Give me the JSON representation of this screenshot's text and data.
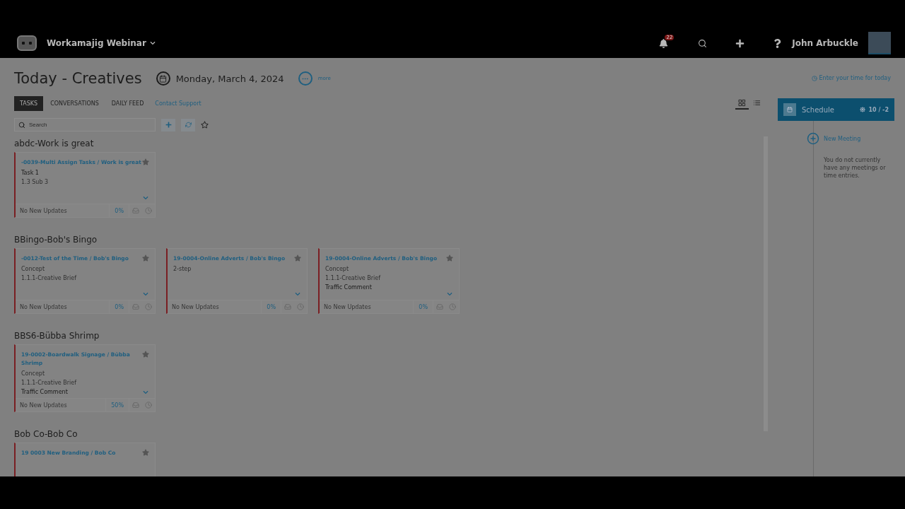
{
  "header": {
    "workspace": "Workamajig Webinar",
    "notification_count": "22",
    "user": "John Arbuckle"
  },
  "page": {
    "title": "Today - Creatives",
    "date": "Monday, March 4, 2024",
    "more": "more",
    "time_link": "Enter your time for today"
  },
  "tabs": [
    {
      "label": "TASKS",
      "selected": true
    },
    {
      "label": "CONVERSATIONS",
      "selected": false
    },
    {
      "label": "DAILY FEED",
      "selected": false
    }
  ],
  "support_link": "Contact Support",
  "search": {
    "placeholder": "Search"
  },
  "views": [
    {
      "kind": "grid",
      "selected": true
    },
    {
      "kind": "list",
      "selected": false
    }
  ],
  "groups": [
    {
      "name": "abdc-Work is great",
      "cards": [
        {
          "title": "-0039-Multi Assign Tasks / Work is great",
          "lines": [
            {
              "text": "Task 1",
              "kind": "primary"
            },
            {
              "text": "1.3 Sub 3",
              "kind": "secondary"
            }
          ],
          "updates": "No New Updates",
          "percent": "0%"
        }
      ]
    },
    {
      "name": "BBingo-Bob's Bingo",
      "cards": [
        {
          "title": "-0012-Test of the Time / Bob's Bingo",
          "lines": [
            {
              "text": "Concept",
              "kind": "secondary"
            },
            {
              "text": "1.1.1-Creative Brief",
              "kind": "secondary"
            }
          ],
          "updates": "No New Updates",
          "percent": "0%"
        },
        {
          "title": "19-0004-Online Adverts / Bob's Bingo",
          "lines": [
            {
              "text": "2-step",
              "kind": "secondary"
            }
          ],
          "updates": "No New Updates",
          "percent": "0%"
        },
        {
          "title": "19-0004-Online Adverts / Bob's Bingo",
          "lines": [
            {
              "text": "Concept",
              "kind": "secondary"
            },
            {
              "text": "1.1.1-Creative Brief",
              "kind": "secondary"
            },
            {
              "text": "Traffic Comment",
              "kind": "primary"
            }
          ],
          "updates": "No New Updates",
          "percent": "0%"
        }
      ]
    },
    {
      "name": "BBS6-Bübba Shrimp",
      "cards": [
        {
          "title": "19-0002-Boardwalk Signage / Bübba Shrimp",
          "lines": [
            {
              "text": "Concept",
              "kind": "secondary"
            },
            {
              "text": "1.1.1-Creative Brief",
              "kind": "secondary"
            },
            {
              "text": "Traffic Comment",
              "kind": "primary"
            }
          ],
          "updates": "No New Updates",
          "percent": "50%"
        }
      ]
    },
    {
      "name": "Bob Co-Bob Co",
      "cards": [
        {
          "title": "19 0003 New Branding / Bob Co"
        }
      ]
    }
  ],
  "schedule": {
    "title": "Schedule",
    "weather": "10 / -2",
    "new_meeting": "New Meeting",
    "empty": "You do not currently have any meetings or time entries."
  }
}
